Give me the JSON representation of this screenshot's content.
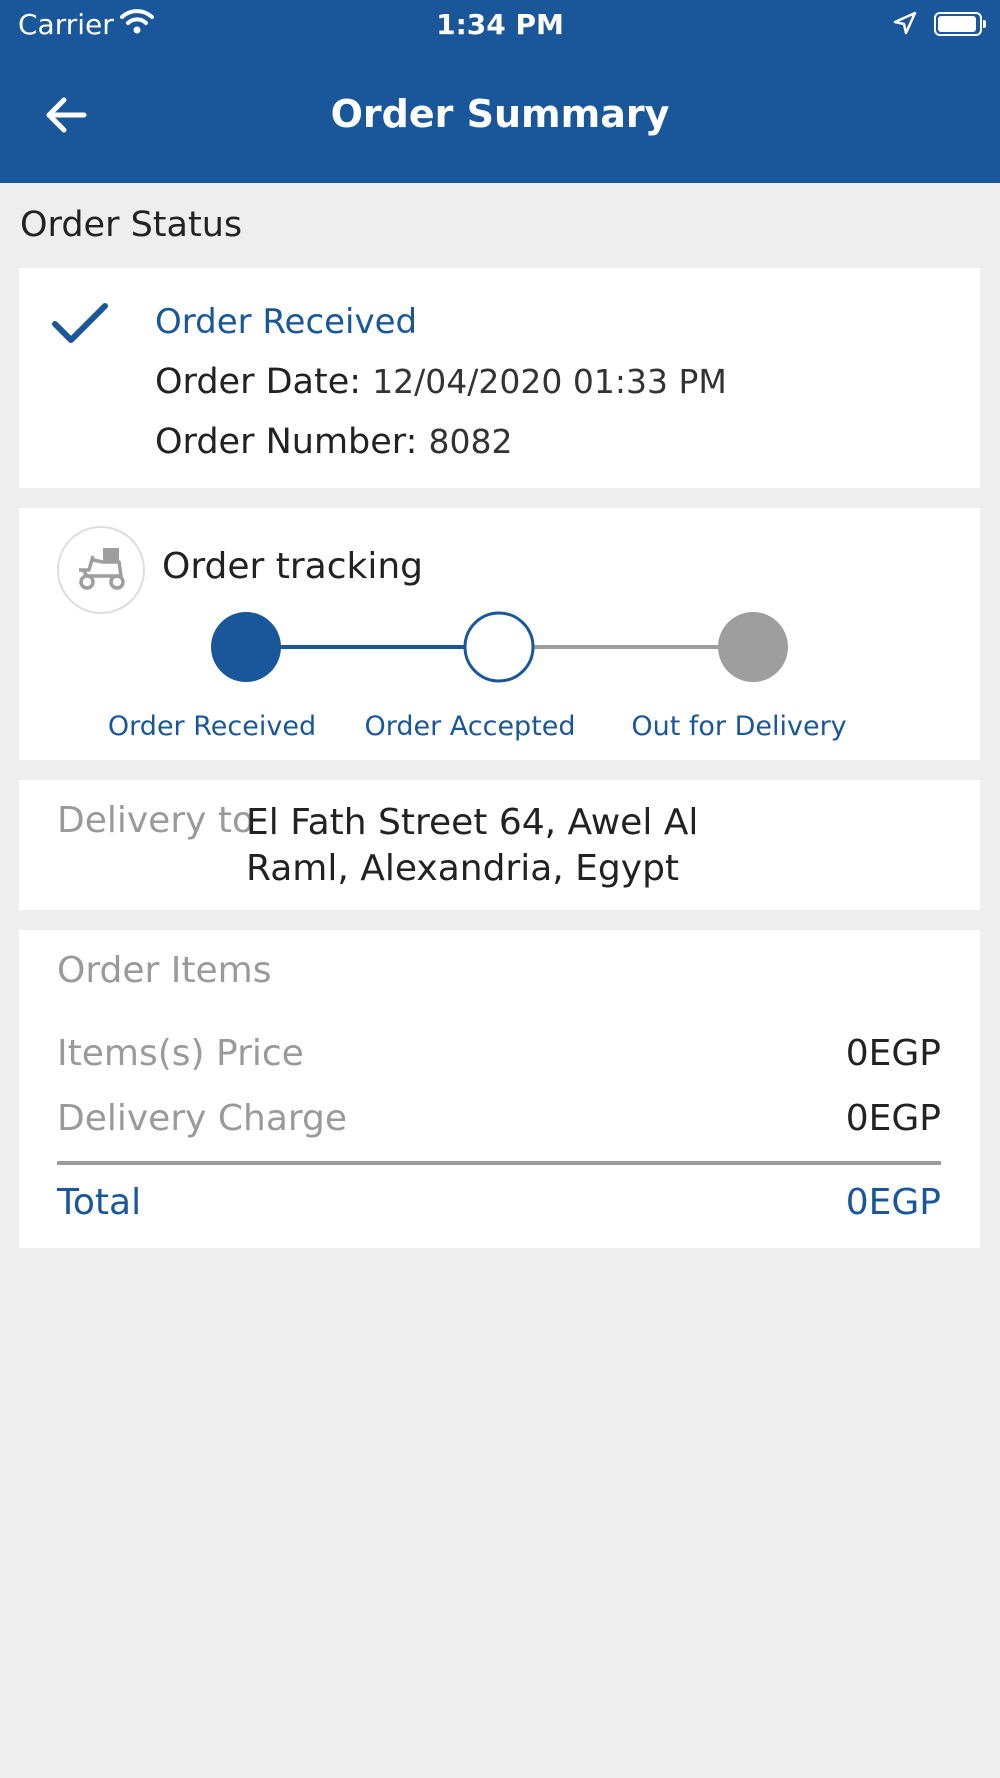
{
  "status_bar": {
    "carrier": "Carrier",
    "time": "1:34 PM",
    "wifi_icon": "wifi-icon",
    "location_icon": "location-arrow-icon",
    "battery_icon": "battery-icon"
  },
  "header": {
    "title": "Order Summary",
    "back_icon": "arrow-left-icon",
    "background_color": "#19579a"
  },
  "order_status": {
    "section_title": "Order Status",
    "status_icon": "checkmark-icon",
    "status_text": "Order Received",
    "date_label": "Order Date:",
    "date_value": "12/04/2020 01:33 PM",
    "number_label": "Order Number:",
    "number_value": "8082"
  },
  "tracking": {
    "title": "Order tracking",
    "icon": "delivery-scooter-icon",
    "steps": [
      {
        "label": "Order Received",
        "state": "completed"
      },
      {
        "label": "Order Accepted",
        "state": "current"
      },
      {
        "label": "Out for Delivery",
        "state": "pending"
      }
    ]
  },
  "delivery": {
    "label": "Delivery to",
    "address": "El Fath Street 64, Awel Al Raml, Alexandria, Egypt"
  },
  "order_items": {
    "title": "Order Items",
    "rows": [
      {
        "label": "Items(s) Price",
        "value": "0EGP"
      },
      {
        "label": "Delivery Charge",
        "value": "0EGP"
      }
    ],
    "total_label": "Total",
    "total_value": "0EGP"
  },
  "colors": {
    "primary": "#19579a",
    "muted": "#9a9a9a",
    "background": "#eeeeee",
    "pending": "#9e9e9e"
  }
}
